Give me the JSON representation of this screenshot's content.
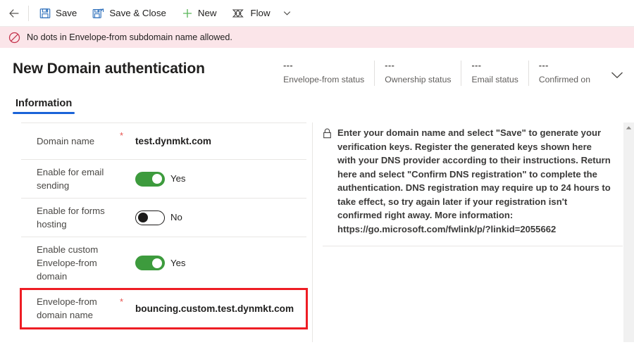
{
  "commandbar": {
    "back_icon": "back-arrow-icon",
    "items": [
      {
        "label": "Save",
        "icon": "save-floppy-icon"
      },
      {
        "label": "Save & Close",
        "icon": "save-and-close-icon"
      },
      {
        "label": "New",
        "icon": "plus-icon"
      },
      {
        "label": "Flow",
        "icon": "flow-icon"
      }
    ],
    "overflow_icon": "chevron-down-icon"
  },
  "notification": {
    "icon": "block-prohibited-icon",
    "message": "No dots in Envelope-from subdomain name allowed."
  },
  "header": {
    "title": "New Domain authentication",
    "expand_icon": "chevron-down-icon",
    "stats": [
      {
        "value": "---",
        "label": "Envelope-from status"
      },
      {
        "value": "---",
        "label": "Ownership status"
      },
      {
        "value": "---",
        "label": "Email status"
      },
      {
        "value": "---",
        "label": "Confirmed on"
      }
    ]
  },
  "tabs": [
    {
      "label": "Information",
      "active": true
    }
  ],
  "form": {
    "fields": [
      {
        "label": "Domain name",
        "required": true,
        "type": "text",
        "value": "test.dynmkt.com",
        "highlight": false,
        "name": "domain-name"
      },
      {
        "label": "Enable for email sending",
        "required": false,
        "type": "toggle",
        "state": "on",
        "value": "Yes",
        "highlight": false,
        "name": "enable-for-email-sending"
      },
      {
        "label": "Enable for forms hosting",
        "required": false,
        "type": "toggle",
        "state": "off",
        "value": "No",
        "highlight": false,
        "name": "enable-for-forms-hosting"
      },
      {
        "label": "Enable custom Envelope-from domain",
        "required": false,
        "type": "toggle",
        "state": "on",
        "value": "Yes",
        "highlight": false,
        "name": "enable-custom-envelope-from-domain"
      },
      {
        "label": "Envelope-from domain name",
        "required": true,
        "type": "text",
        "value": "bouncing.custom.test.dynmkt.com",
        "highlight": true,
        "name": "envelope-from-domain-name"
      }
    ]
  },
  "info_panel": {
    "icon": "lock-icon",
    "text": "Enter your domain name and select \"Save\" to generate your verification keys. Register the generated keys shown here with your DNS provider according to their instructions. Return here and select \"Confirm DNS registration\" to complete the authentication. DNS registration may require up to 24 hours to take effect, so try again later if your registration isn't confirmed right away. More information: https://go.microsoft.com/fwlink/p/?linkid=2055662"
  },
  "colors": {
    "accent_blue": "#1a63d8",
    "toggle_on_green": "#3d9b3d",
    "error_banner_bg": "#fbe5e9",
    "error_red": "#c4314b",
    "highlight_red": "#ee1d24",
    "required_star": "#e8534f",
    "save_icon_blue": "#2c6fbb",
    "new_icon_green": "#5bb75b"
  },
  "scrollbar": {
    "up_arrow_icon": "scroll-up-arrow-icon"
  }
}
